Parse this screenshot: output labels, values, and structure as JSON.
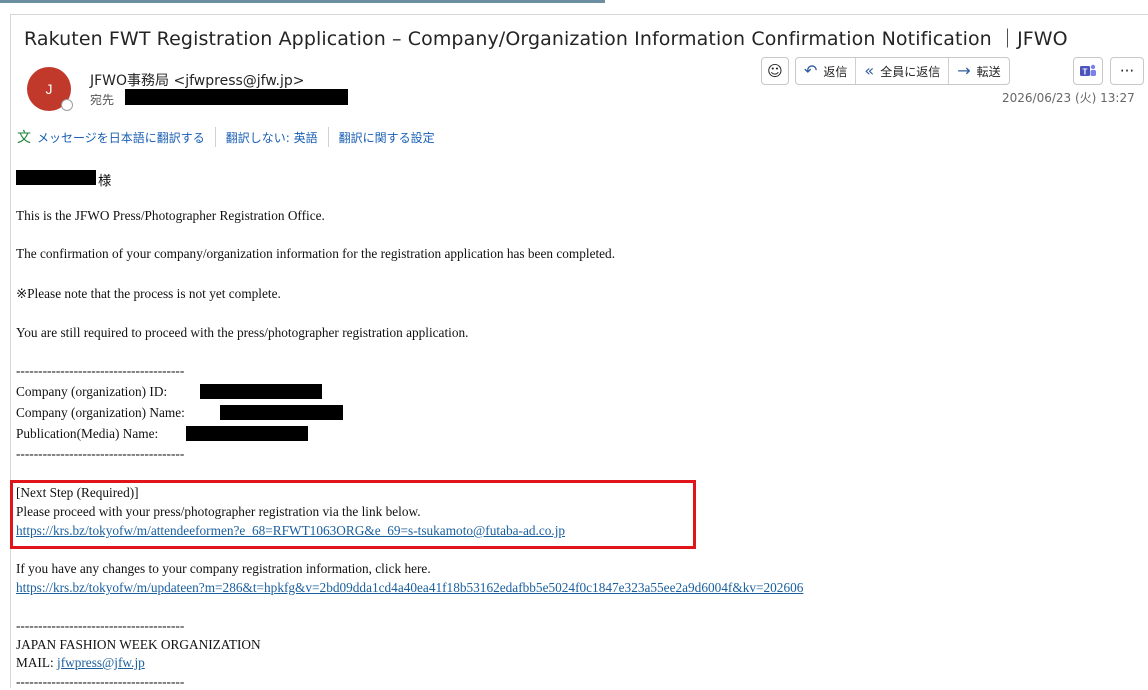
{
  "subject": "Rakuten FWT Registration Application – Company/Organization Information Confirmation Notification ｜JFWO",
  "sender": {
    "avatar_initial": "J",
    "from": "JFWO事務局 <jfwpress@jfw.jp>",
    "to_label": "宛先"
  },
  "actions": {
    "emoji": "☺",
    "reply": "返信",
    "reply_all": "全員に返信",
    "forward": "転送",
    "teams": "Teams",
    "more": "···"
  },
  "icons": {
    "emoji": "smiley-icon",
    "reply": "reply-arrow-icon",
    "reply_all": "reply-all-arrow-icon",
    "forward": "forward-arrow-icon",
    "teams": "teams-icon",
    "more": "more-icon",
    "translate": "translate-icon"
  },
  "date": "2026/06/23 (火) 13:27",
  "translation": {
    "translate": "メッセージを日本語に翻訳する",
    "dont_translate": "翻訳しない: 英語",
    "settings": "翻訳に関する設定"
  },
  "body": {
    "salutation_suffix": "様",
    "intro": "This is the JFWO Press/Photographer Registration Office.",
    "confirmed": "The confirmation of your company/organization information for the registration application has been completed.",
    "note": "※Please note that the process is not yet complete.",
    "still": "You are still required to proceed with the press/photographer registration application.",
    "divider": "--------------------------------------",
    "company_id_label": "Company (organization) ID:",
    "company_name_label": "Company (organization) Name:",
    "publication_label": "Publication(Media) Name:",
    "next_step": "[Next Step (Required)]",
    "proceed": "Please proceed with your press/photographer registration via the link below.",
    "registration_link": "https://krs.bz/tokyofw/m/attendeeformen?e_68=RFWT1063ORG&e_69=s-tsukamoto@futaba-ad.co.jp",
    "changes": "If you have any changes to your company registration information, click here.",
    "update_link": "https://krs.bz/tokyofw/m/updateen?m=286&t=hpkfg&v=2bd09dda1cd4a40ea41f18b53162edafbb5e5024f0c1847e323a55ee2a9d6004f&kv=202606",
    "divider2": "--------------------------------------",
    "org_name": "JAPAN FASHION WEEK ORGANIZATION",
    "mail_label": "MAIL:",
    "mail_link": "jfwpress@jfw.jp",
    "divider3": "--------------------------------------"
  },
  "colors": {
    "avatar": "#c0392b",
    "highlight_box": "#e0141b",
    "link": "#1a5f9e"
  }
}
